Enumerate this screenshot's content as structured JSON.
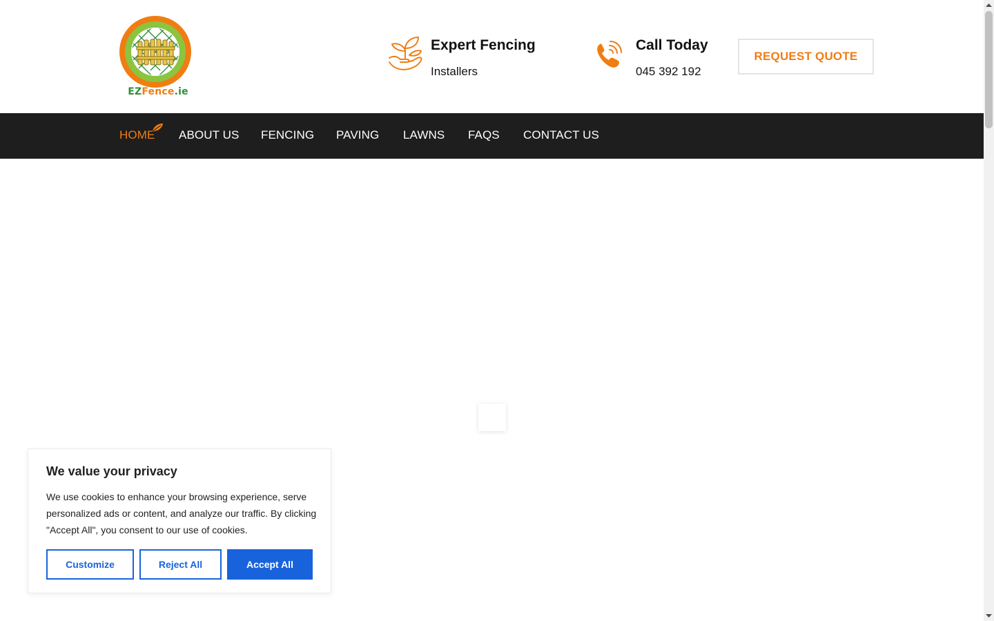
{
  "header": {
    "logo": {
      "text_ez": "EZ",
      "text_fence": "Fence",
      "text_ie": ".ie"
    },
    "expert": {
      "title": "Expert Fencing",
      "subtitle": "Installers",
      "icon": "plant-hand-icon"
    },
    "call": {
      "title": "Call Today",
      "phone": "045 392 192",
      "icon": "phone-icon"
    },
    "quote_button": "REQUEST QUOTE"
  },
  "nav": {
    "items": [
      {
        "label": "HOME",
        "active": true
      },
      {
        "label": "ABOUT US"
      },
      {
        "label": "FENCING"
      },
      {
        "label": "PAVING"
      },
      {
        "label": "LAWNS"
      },
      {
        "label": "FAQS"
      },
      {
        "label": "CONTACT US"
      }
    ]
  },
  "cookie_banner": {
    "title": "We value your privacy",
    "text": "We use cookies to enhance your browsing experience, serve personalized ads or content, and analyze our traffic. By clicking \"Accept All\", you consent to our use of cookies.",
    "customize": "Customize",
    "reject": "Reject All",
    "accept": "Accept All"
  },
  "colors": {
    "accent": "#f07d12",
    "nav_bg": "#1e1e1e",
    "cookie_blue": "#1863dc",
    "logo_green": "#2f8f3a"
  }
}
